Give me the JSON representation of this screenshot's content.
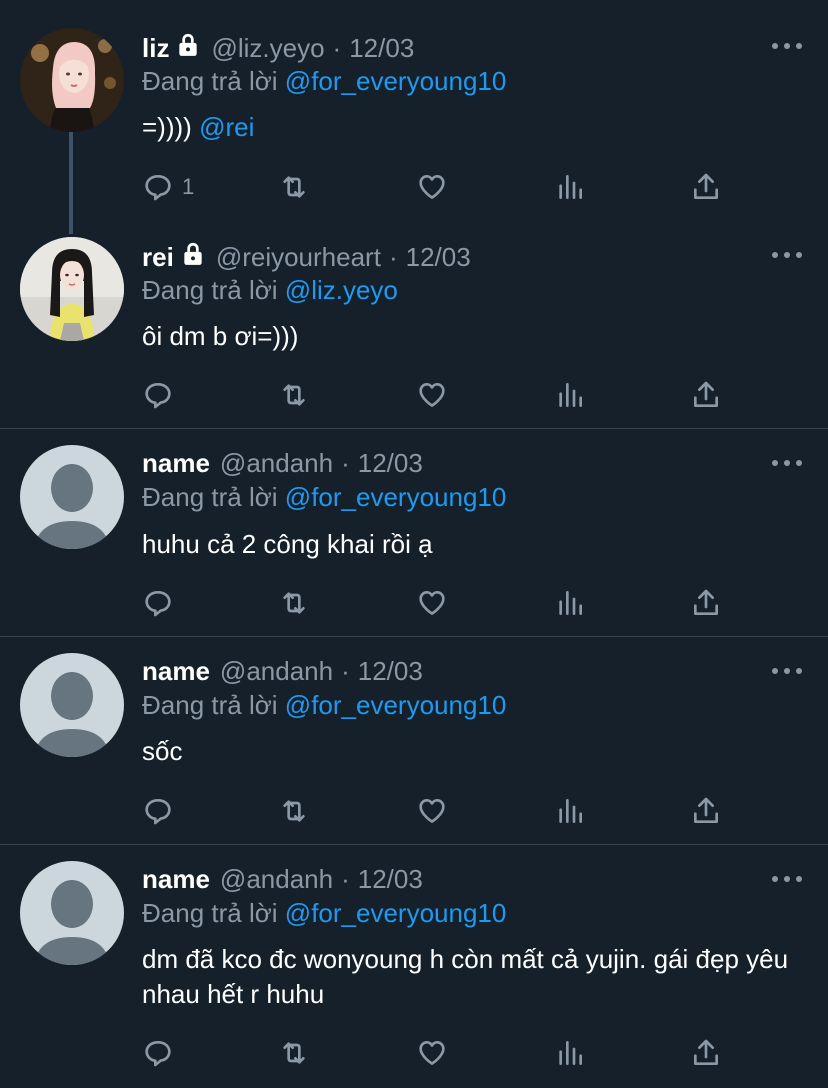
{
  "reply_prefix": "Đang trả lời",
  "tweets": [
    {
      "name": "liz",
      "locked": true,
      "handle": "@liz.yeyo",
      "date": "12/03",
      "reply_to": "@for_everyoung10",
      "text": "=))))",
      "text_mention": "@rei",
      "reply_count": "1"
    },
    {
      "name": "rei",
      "locked": true,
      "handle": "@reiyourheart",
      "date": "12/03",
      "reply_to": "@liz.yeyo",
      "text": "ôi dm b ơi=)))",
      "reply_count": ""
    },
    {
      "name": "name",
      "locked": false,
      "handle": "@andanh",
      "date": "12/03",
      "reply_to": "@for_everyoung10",
      "text": "huhu cả 2 công khai rồi ạ",
      "reply_count": ""
    },
    {
      "name": "name",
      "locked": false,
      "handle": "@andanh",
      "date": "12/03",
      "reply_to": "@for_everyoung10",
      "text": "sốc",
      "reply_count": ""
    },
    {
      "name": "name",
      "locked": false,
      "handle": "@andanh",
      "date": "12/03",
      "reply_to": "@for_everyoung10",
      "text": "dm đã kco đc wonyoung h còn mất cả yujin. gái đẹp yêu nhau hết r huhu",
      "reply_count": ""
    }
  ],
  "separator": "·",
  "colors": {
    "background": "#15202b",
    "secondary_text": "#8b98a5",
    "accent": "#1d9bf0",
    "divider": "#38444d"
  },
  "icons": [
    "reply-icon",
    "retweet-icon",
    "like-icon",
    "views-icon",
    "share-icon",
    "lock-icon",
    "more-icon"
  ]
}
